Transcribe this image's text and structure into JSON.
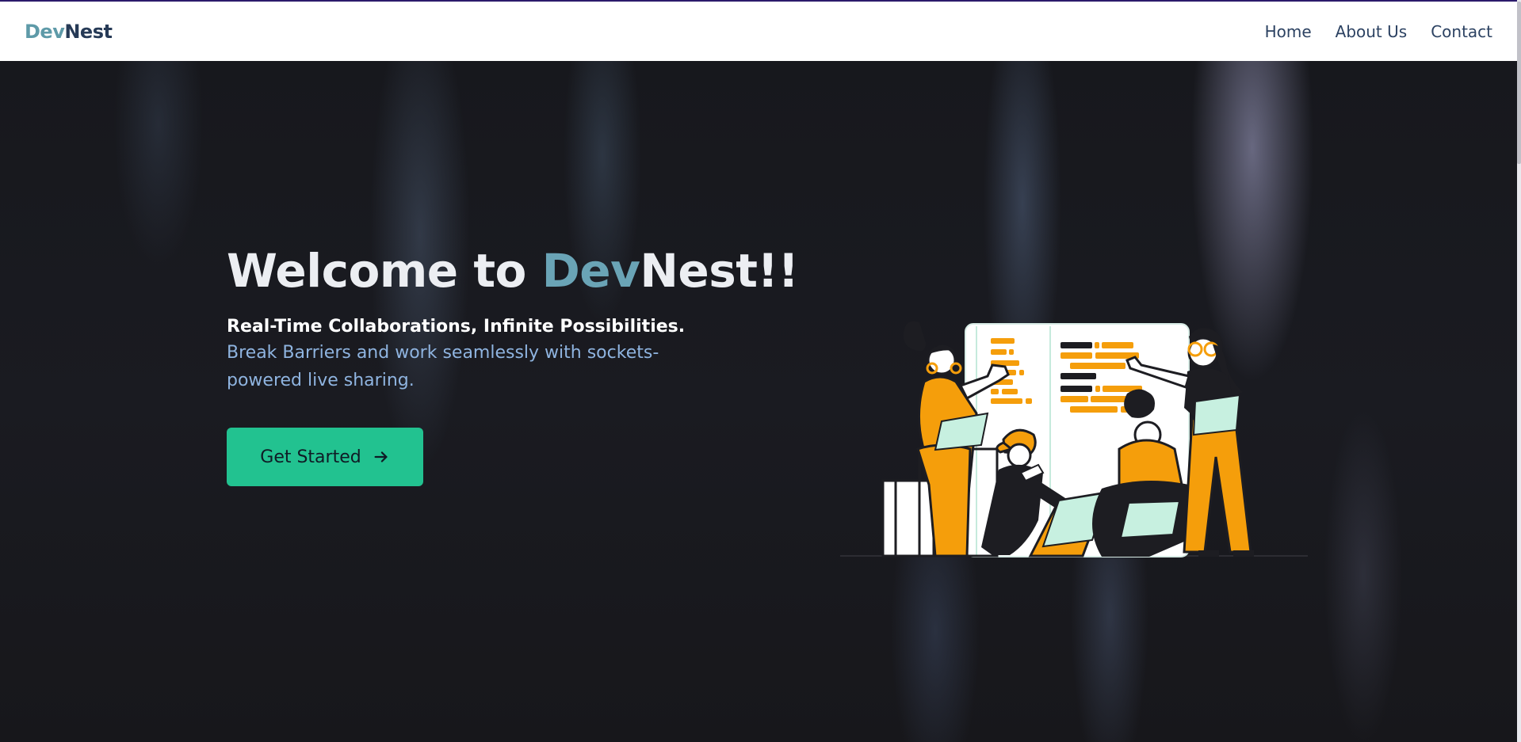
{
  "navbar": {
    "brand_prefix": "Dev",
    "brand_suffix": "Nest",
    "links": [
      "Home",
      "About Us",
      "Contact"
    ]
  },
  "hero": {
    "headline_prefix": "Welcome to ",
    "headline_brand_prefix": "Dev",
    "headline_brand_suffix": "Nest!!",
    "subtitle": "Real-Time Collaborations, Infinite Possibilities.",
    "description": "Break Barriers and work seamlessly with sockets-powered live sharing.",
    "cta_label": "Get Started"
  },
  "colors": {
    "accent": "#22c290",
    "brand_dev": "#5e9aa8",
    "illustration_orange": "#f59e0b",
    "illustration_mint": "#c7f0e0"
  },
  "icons": [
    "arrow-right-icon"
  ]
}
